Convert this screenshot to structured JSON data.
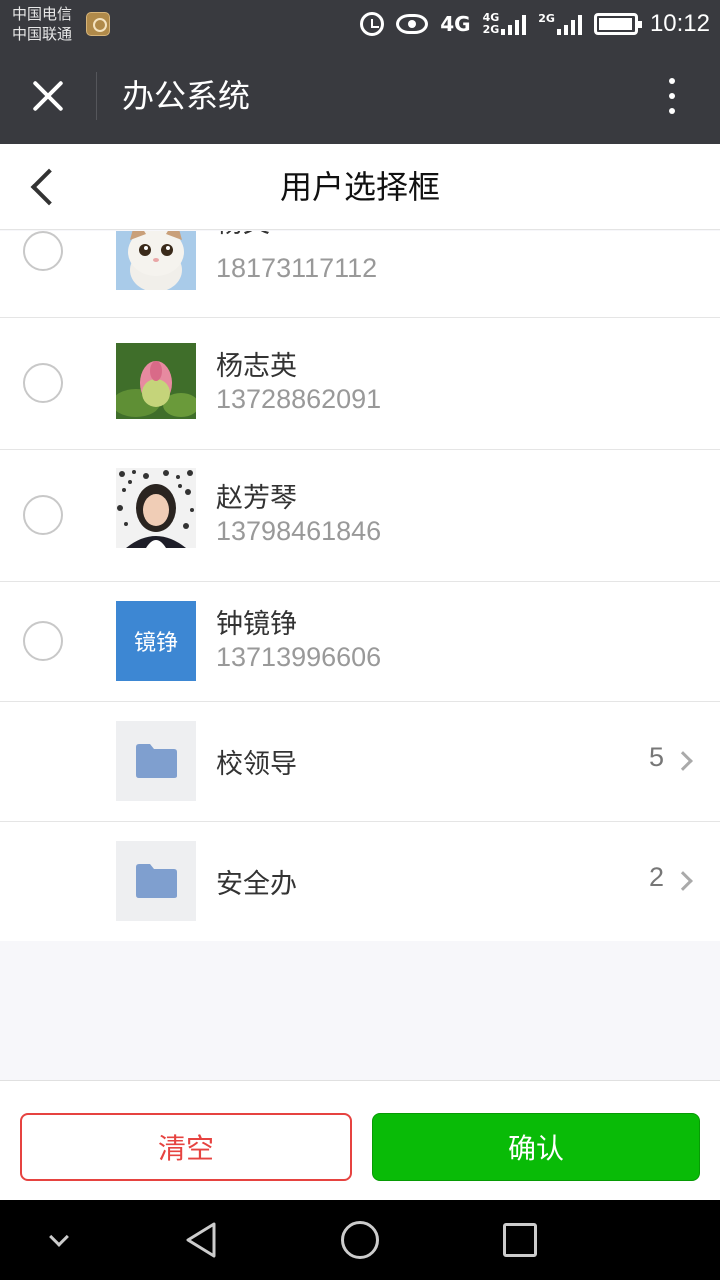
{
  "status_bar": {
    "carrier_1": "中国电信",
    "carrier_2": "中国联通",
    "network_main": "4G",
    "network_small_top": "4G",
    "network_small_bottom": "2G",
    "network_right": "2G",
    "time": "10:12"
  },
  "app_bar": {
    "title": "办公系统"
  },
  "page": {
    "title": "用户选择框"
  },
  "users": [
    {
      "name": "杨文",
      "phone": "18173117112",
      "avatar": "cat-photo"
    },
    {
      "name": "杨志英",
      "phone": "13728862091",
      "avatar": "lotus-photo"
    },
    {
      "name": "赵芳琴",
      "phone": "13798461846",
      "avatar": "portrait-photo"
    },
    {
      "name": "钟镜铮",
      "phone": "13713996606",
      "avatar_text": "镜铮"
    }
  ],
  "groups": [
    {
      "label": "校领导",
      "count": "5"
    },
    {
      "label": "安全办",
      "count": "2"
    }
  ],
  "actions": {
    "clear_label": "清空",
    "confirm_label": "确认"
  },
  "colors": {
    "header_bg": "#393a3f",
    "confirm_green": "#09bb07",
    "clear_red": "#e64340",
    "avatar_blue": "#3d87d3",
    "folder_blue": "#7f9fcf"
  }
}
